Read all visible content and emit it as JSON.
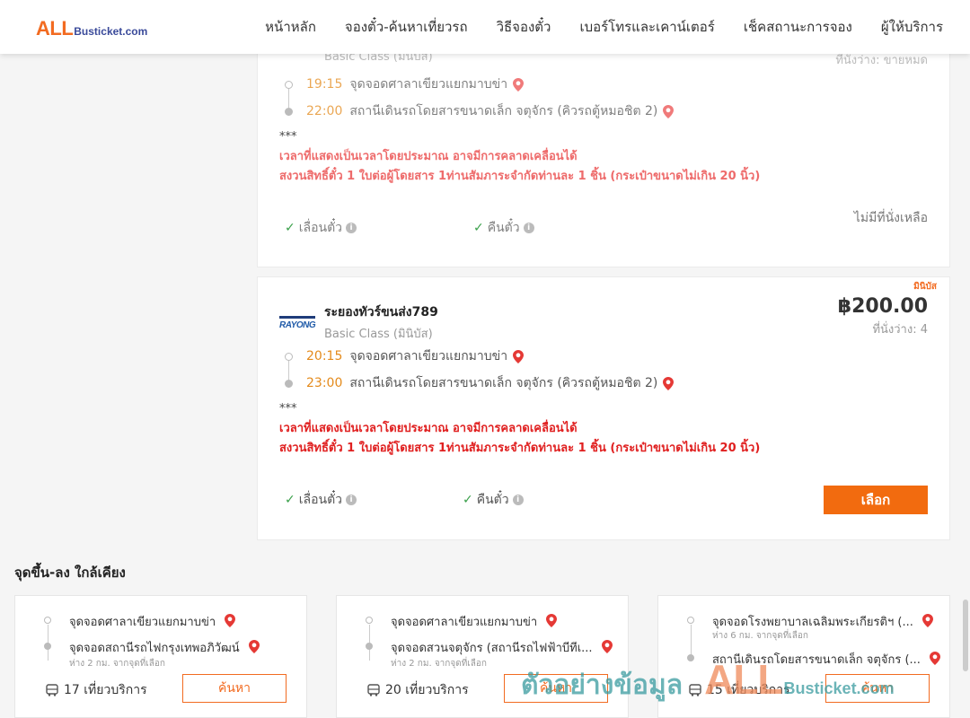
{
  "header": {
    "logo_big": "ALL",
    "logo_small": "Busticket.com",
    "nav": [
      "หน้าหลัก",
      "จองตั๋ว-ค้นหาเที่ยวรถ",
      "วิธีจองตั๋ว",
      "เบอร์โทรและเคาน์เตอร์",
      "เช็คสถานะการจอง",
      "ผู้ให้บริการ"
    ]
  },
  "trip1": {
    "class_partial": "Basic Class (มินิบัส)",
    "seats_partial": "ที่นั่งว่าง: ขายหมด",
    "depart_time": "19:15",
    "depart_place": "จุดจอดศาลาเขียวแยกมาบข่า",
    "arrive_time": "22:00",
    "arrive_place": "สถานีเดินรถโดยสารขนาดเล็ก จตุจักร (คิวรถตู้หมอชิต 2)",
    "stars": "***",
    "note1": "เวลาที่แสดงเป็นเวลาโดยประมาณ อาจมีการคลาดเคลื่อนได้",
    "note2": "สงวนสิทธิ์ตั๋ว 1 ใบต่อผู้โดยสาร 1ท่านสัมภาระจำกัดท่านละ 1 ชิ้น (กระเป๋าขนาดไม่เกิน 20 นิ้ว)",
    "perk1": "เลื่อนตั๋ว",
    "perk2": "คืนตั๋ว",
    "status": "ไม่มีที่นั่งเหลือ"
  },
  "trip2": {
    "tag": "มินิบัส",
    "operator_logo": "RAYONG",
    "operator": "ระยองทัวร์ขนส่ง789",
    "class": "Basic Class (มินิบัส)",
    "price": "฿200.00",
    "seats": "ที่นั่งว่าง: 4",
    "depart_time": "20:15",
    "depart_place": "จุดจอดศาลาเขียวแยกมาบข่า",
    "arrive_time": "23:00",
    "arrive_place": "สถานีเดินรถโดยสารขนาดเล็ก จตุจักร (คิวรถตู้หมอชิต 2)",
    "stars": "***",
    "note1": "เวลาที่แสดงเป็นเวลาโดยประมาณ อาจมีการคลาดเคลื่อนได้",
    "note2": "สงวนสิทธิ์ตั๋ว 1 ใบต่อผู้โดยสาร 1ท่านสัมภาระจำกัดท่านละ 1 ชิ้น (กระเป๋าขนาดไม่เกิน 20 นิ้ว)",
    "perk1": "เลื่อนตั๋ว",
    "perk2": "คืนตั๋ว",
    "select_label": "เลือก"
  },
  "nearby": {
    "title": "จุดขึ้น-ลง ใกล้เคียง",
    "cards": [
      {
        "from": "จุดจอดศาลาเขียวแยกมาบข่า",
        "from_dist": "",
        "to": "จุดจอดสถานีรถไฟกรุงเทพอภิวัฒน์",
        "to_dist": "ห่าง 2 กม. จากจุดที่เลือก",
        "trips": "17 เที่ยวบริการ",
        "btn": "ค้นหา"
      },
      {
        "from": "จุดจอดศาลาเขียวแยกมาบข่า",
        "from_dist": "",
        "to": "จุดจอดสวนจตุจักร (สถานีรถไฟฟ้าบีทีเ...",
        "to_dist": "ห่าง 2 กม. จากจุดที่เลือก",
        "trips": "20 เที่ยวบริการ",
        "btn": "ค้นหา"
      },
      {
        "from": "จุดจอดโรงพยาบาลเฉลิมพระเกียรติฯ (...",
        "from_dist": "ห่าง 6 กม. จากจุดที่เลือก",
        "to": "สถานีเดินรถโดยสารขนาดเล็ก จตุจักร (...",
        "to_dist": "",
        "trips": "15 เที่ยวบริการ",
        "btn": "ค้นหา"
      }
    ]
  },
  "watermark": {
    "text": "ตัวอย่างข้อมูล",
    "brand": "ALL",
    "site": "Busticket.com"
  },
  "colors": {
    "accent": "#f26b21",
    "warning": "#e02020",
    "time": "#e48a1b",
    "check": "#3aa04a"
  }
}
